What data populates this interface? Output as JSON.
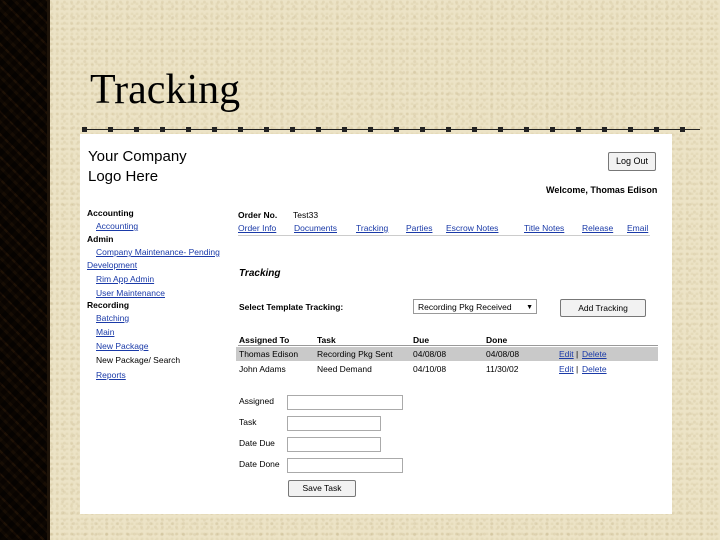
{
  "slide": {
    "title": "Tracking"
  },
  "header": {
    "logo_line1": "Your Company",
    "logo_line2": "Logo Here",
    "logout_label": "Log Out",
    "welcome": "Welcome, Thomas Edison"
  },
  "sidebar": {
    "accounting_label": "Accounting",
    "accounting_link": "Accounting",
    "admin_label": "Admin",
    "company_maint_1": "Company Maintenance- Pending",
    "company_maint_2": "Development",
    "rim_admin": "Rim App Admin",
    "user_maint": "User Maintenance",
    "recording_label": "Recording",
    "batching": "Batching",
    "main": "Main",
    "new_package": "New Package",
    "new_package_search": "New Package/ Search",
    "reports": "Reports"
  },
  "order": {
    "label": "Order No.",
    "value": "Test33"
  },
  "tabs": [
    "Order Info",
    "Documents",
    "Tracking",
    "Parties",
    "Escrow Notes",
    "Title Notes",
    "Release",
    "Email"
  ],
  "tracking": {
    "section_title": "Tracking",
    "select_label": "Select Template Tracking:",
    "select_value": "Recording Pkg Received",
    "add_label": "Add Tracking",
    "columns": [
      "Assigned To",
      "Task",
      "Due",
      "Done"
    ],
    "rows": [
      {
        "assigned": "Thomas Edison",
        "task": "Recording Pkg Sent",
        "due": "04/08/08",
        "done": "04/08/08",
        "edit": "Edit",
        "sep": "|",
        "delete": "Delete"
      },
      {
        "assigned": "John Adams",
        "task": "Need Demand",
        "due": "04/10/08",
        "done": "11/30/02",
        "edit": "Edit",
        "sep": "|",
        "delete": "Delete"
      }
    ]
  },
  "form": {
    "assigned_label": "Assigned",
    "task_label": "Task",
    "date_due_label": "Date Due",
    "date_done_label": "Date Done",
    "save_label": "Save Task"
  }
}
